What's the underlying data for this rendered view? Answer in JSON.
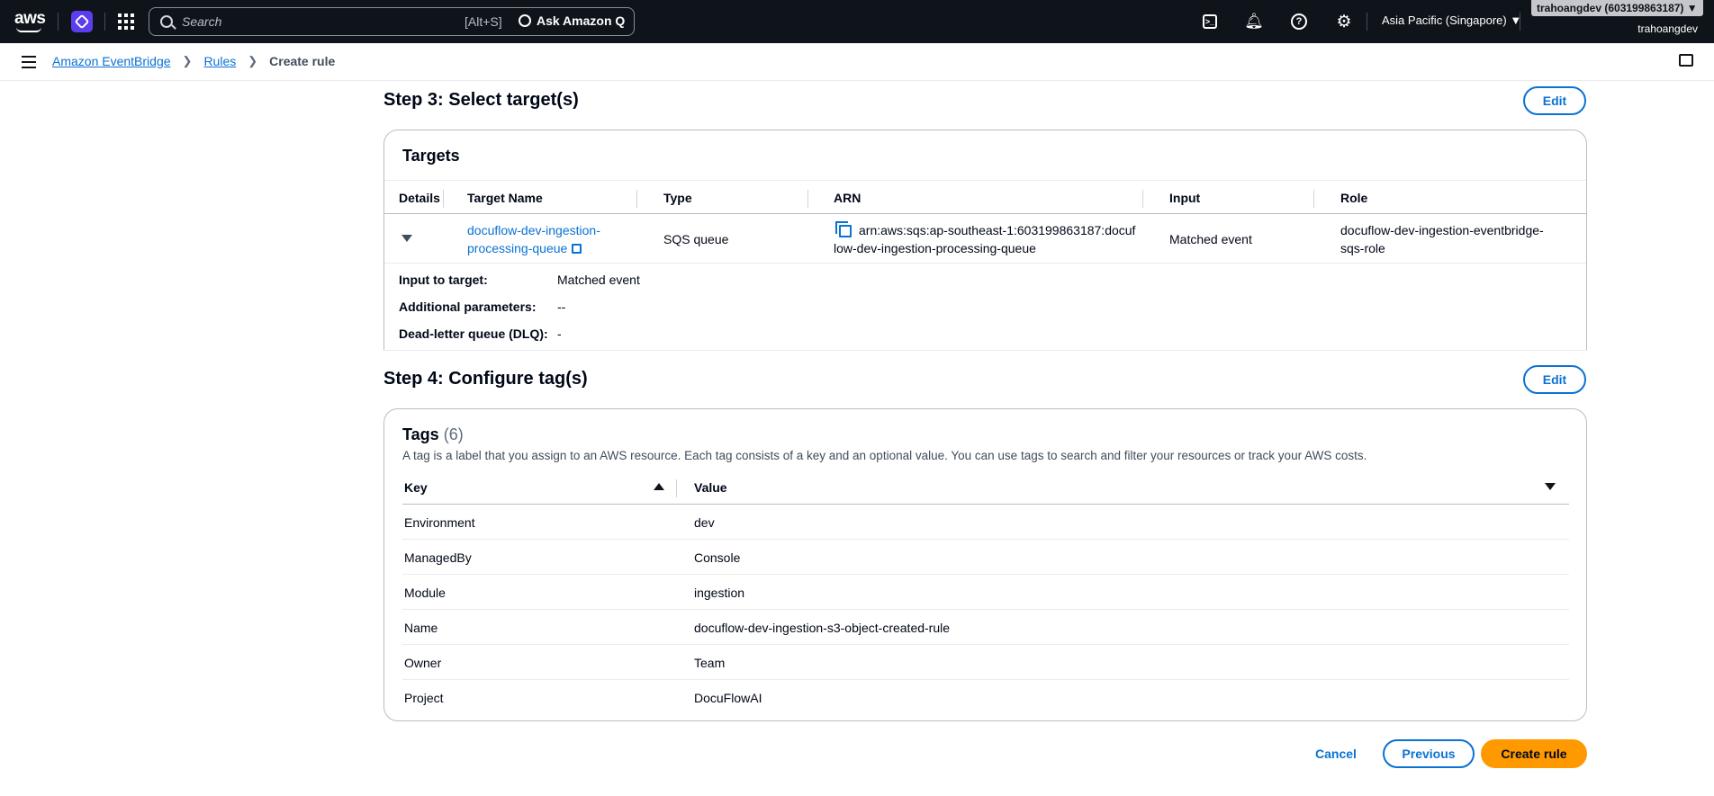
{
  "topnav": {
    "logo_text": "aws",
    "search_placeholder": "Search",
    "search_shortcut": "[Alt+S]",
    "ask_q_label": "Ask Amazon Q",
    "region": "Asia Pacific (Singapore) ▼",
    "account_badge": "trahoangdev (603199863187) ▼",
    "account_user": "trahoangdev"
  },
  "breadcrumb": {
    "items": [
      "Amazon EventBridge",
      "Rules"
    ],
    "current": "Create rule"
  },
  "step3": {
    "title": "Step 3: Select target(s)",
    "edit_label": "Edit",
    "container_title": "Targets",
    "columns": [
      "Details",
      "Target Name",
      "Type",
      "ARN",
      "Input",
      "Role"
    ],
    "row": {
      "target_name_line1": "docuflow-dev-ingestion-",
      "target_name_line2": "processing-queue",
      "type": "SQS queue",
      "arn_line1": "arn:aws:sqs:ap-southeast-1:603199863187:docuf",
      "arn_line2": "low-dev-ingestion-processing-queue",
      "input": "Matched event",
      "role_line1": "docuflow-dev-ingestion-eventbridge-",
      "role_line2": "sqs-role"
    },
    "details": [
      {
        "key": "Input to target:",
        "value": "Matched event"
      },
      {
        "key": "Additional parameters:",
        "value": "--"
      },
      {
        "key": "Dead-letter queue (DLQ):",
        "value": "-"
      }
    ]
  },
  "step4": {
    "title": "Step 4: Configure tag(s)",
    "edit_label": "Edit",
    "container_title": "Tags",
    "count": "(6)",
    "description": "A tag is a label that you assign to an AWS resource. Each tag consists of a key and an optional value. You can use tags to search and filter your resources or track your AWS costs.",
    "columns": [
      "Key",
      "Value"
    ],
    "rows": [
      {
        "key": "Environment",
        "value": "dev"
      },
      {
        "key": "ManagedBy",
        "value": "Console"
      },
      {
        "key": "Module",
        "value": "ingestion"
      },
      {
        "key": "Name",
        "value": "docuflow-dev-ingestion-s3-object-created-rule"
      },
      {
        "key": "Owner",
        "value": "Team"
      },
      {
        "key": "Project",
        "value": "DocuFlowAI"
      }
    ]
  },
  "footer": {
    "cancel_label": "Cancel",
    "previous_label": "Previous",
    "create_label": "Create rule"
  },
  "colors": {
    "nav_bg": "#0f141a",
    "link": "#0972d3",
    "primary_button": "#ff9900",
    "amazon_q": "#5c3eef"
  }
}
